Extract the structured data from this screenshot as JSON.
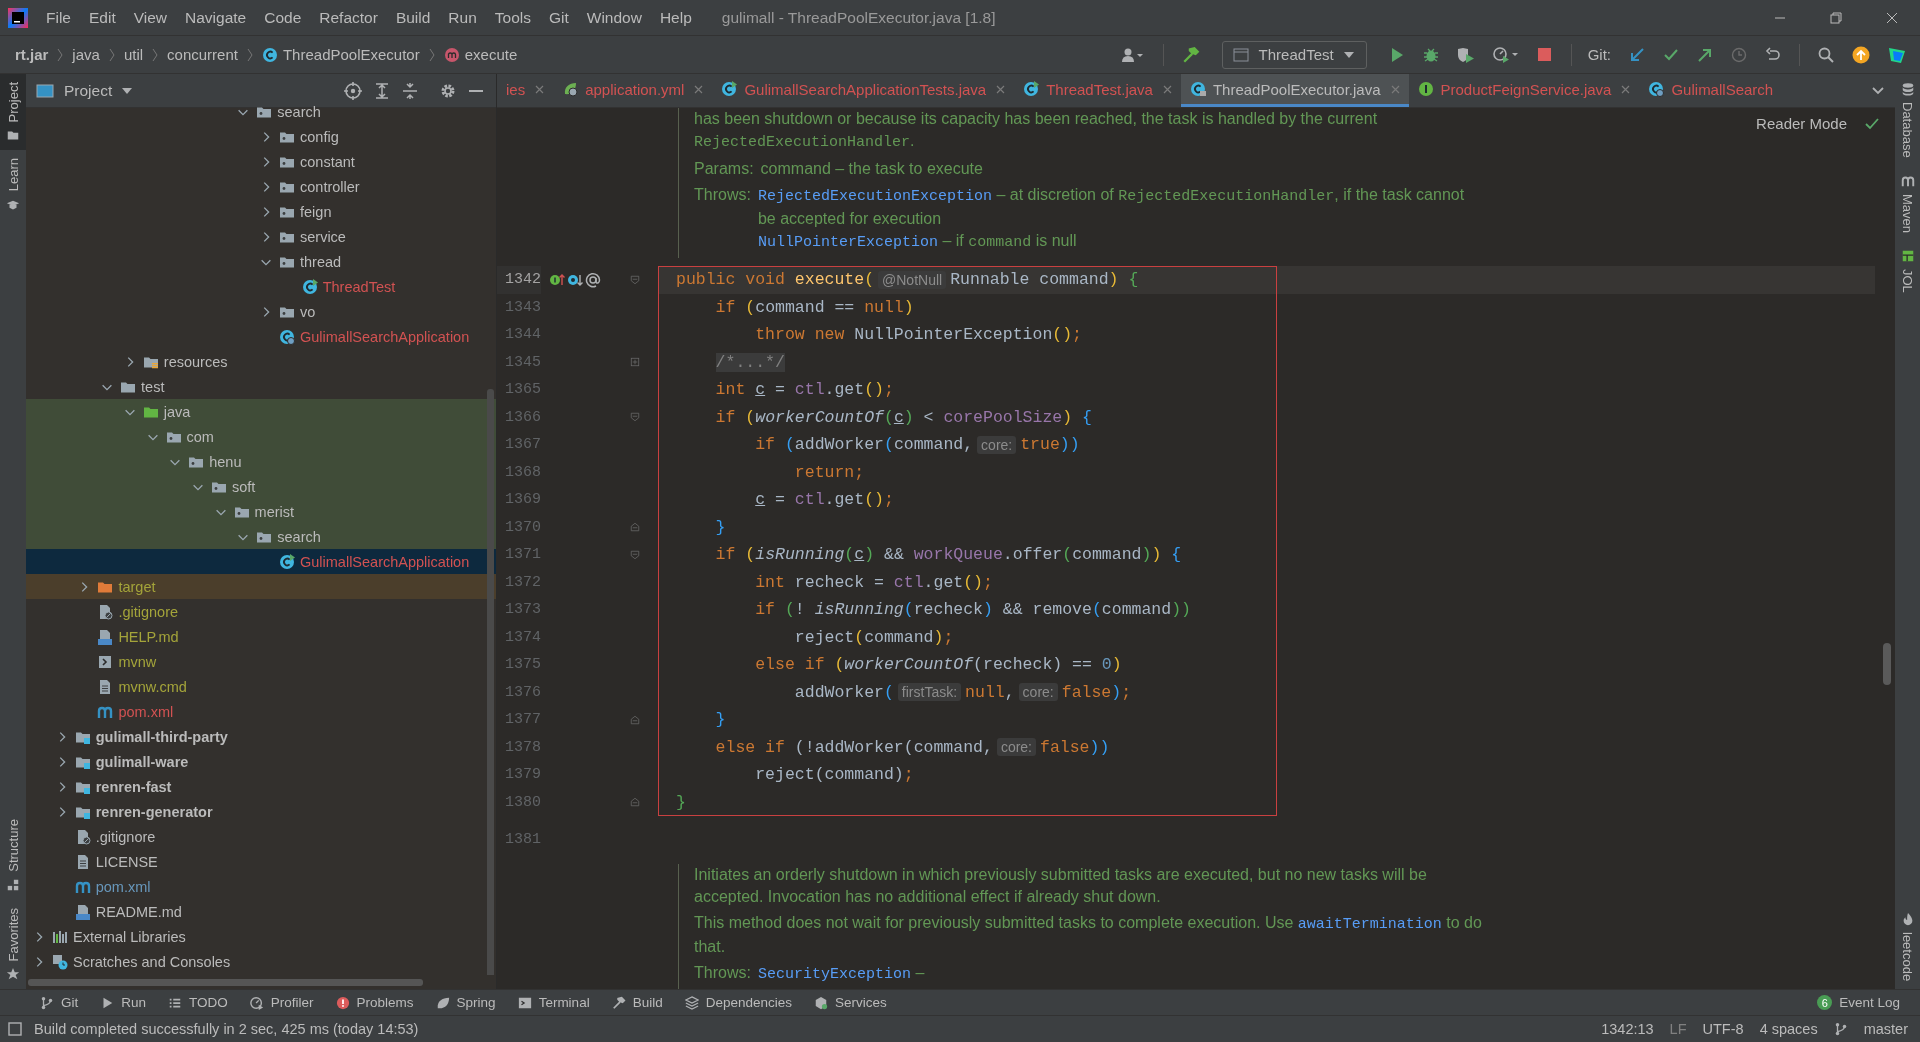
{
  "window": {
    "title": "gulimall - ThreadPoolExecutor.java [1.8]"
  },
  "menu": [
    "File",
    "Edit",
    "View",
    "Navigate",
    "Code",
    "Refactor",
    "Build",
    "Run",
    "Tools",
    "Git",
    "Window",
    "Help"
  ],
  "breadcrumbs": [
    {
      "label": "rt.jar",
      "kind": "root"
    },
    {
      "label": "java",
      "kind": "plain"
    },
    {
      "label": "util",
      "kind": "plain"
    },
    {
      "label": "concurrent",
      "kind": "plain"
    },
    {
      "label": "ThreadPoolExecutor",
      "kind": "class"
    },
    {
      "label": "execute",
      "kind": "method"
    }
  ],
  "run_config": {
    "label": "ThreadTest"
  },
  "git_label": "Git:",
  "left_strip": {
    "top": [
      {
        "label": "Project",
        "kind": "folder",
        "selected": true
      },
      {
        "label": "Learn",
        "kind": "cap",
        "selected": false
      }
    ],
    "bottom": [
      {
        "label": "Structure",
        "kind": "blocks",
        "selected": false
      },
      {
        "label": "Favorites",
        "kind": "star",
        "selected": false
      }
    ]
  },
  "right_strip": {
    "top": [
      {
        "label": "Database",
        "kind": "db"
      },
      {
        "label": "Maven",
        "kind": "maven"
      },
      {
        "label": "JOL",
        "kind": "jol"
      }
    ],
    "bottom": [
      {
        "label": "leetcode",
        "kind": "leet"
      }
    ]
  },
  "project_panel": {
    "title": "Project"
  },
  "tree": [
    {
      "children": [
        {
          "children": [
            {
              "children": [
                {
                  "children": [
                    {
                      "children": [
                        {
                          "children": [
                            {
                              "children": [
                                {
                                  "children": [
                                    {
                                      "children": [
                                        {
                                          "label": "search",
                                          "kind": "package",
                                          "expanded": true,
                                          "selected": false,
                                          "children": [
                                            {
                                              "label": "config",
                                              "kind": "package",
                                              "expanded": false,
                                              "selected": false
                                            },
                                            {
                                              "label": "constant",
                                              "kind": "package",
                                              "expanded": false,
                                              "selected": false
                                            },
                                            {
                                              "label": "controller",
                                              "kind": "package",
                                              "expanded": false,
                                              "selected": false
                                            },
                                            {
                                              "label": "feign",
                                              "kind": "package",
                                              "expanded": false,
                                              "selected": false
                                            },
                                            {
                                              "label": "service",
                                              "kind": "package",
                                              "expanded": false,
                                              "selected": false
                                            },
                                            {
                                              "label": "thread",
                                              "kind": "package",
                                              "expanded": true,
                                              "selected": false,
                                              "children": [
                                                {
                                                  "label": "ThreadTest",
                                                  "kind": "class-run",
                                                  "selected": false,
                                                  "color": "#d25252"
                                                }
                                              ]
                                            },
                                            {
                                              "label": "vo",
                                              "kind": "package",
                                              "expanded": false,
                                              "selected": false
                                            },
                                            {
                                              "label": "GulimallSearchApplication",
                                              "kind": "spring-app",
                                              "selected": false,
                                              "color": "#d25252"
                                            }
                                          ]
                                        }
                                      ]
                                    }
                                  ]
                                }
                              ]
                            }
                          ]
                        }
                      ]
                    },
                    {
                      "label": "resources",
                      "kind": "resources",
                      "expanded": false,
                      "selected": false
                    }
                  ]
                },
                {
                  "label": "test",
                  "kind": "folder",
                  "expanded": true,
                  "selected": false,
                  "children": [
                    {
                      "label": "java",
                      "kind": "test-root",
                      "expanded": true,
                      "selected": false,
                      "children": [
                        {
                          "label": "com",
                          "kind": "package",
                          "expanded": true,
                          "selected": false,
                          "children": [
                            {
                              "label": "henu",
                              "kind": "package",
                              "expanded": true,
                              "selected": false,
                              "children": [
                                {
                                  "label": "soft",
                                  "kind": "package",
                                  "expanded": true,
                                  "selected": false,
                                  "children": [
                                    {
                                      "label": "merist",
                                      "kind": "package",
                                      "expanded": true,
                                      "selected": false,
                                      "children": [
                                        {
                                          "label": "search",
                                          "kind": "package",
                                          "expanded": true,
                                          "selected": false,
                                          "children": [
                                            {
                                              "label": "GulimallSearchApplication",
                                              "kind": "class-run",
                                              "selected": true,
                                              "color": "#d25252"
                                            }
                                          ]
                                        }
                                      ]
                                    }
                                  ]
                                }
                              ]
                            }
                          ]
                        }
                      ]
                    }
                  ]
                }
              ]
            },
            {
              "label": "target",
              "kind": "excluded",
              "expanded": false,
              "selected": false,
              "color": "#a4a43a"
            },
            {
              "label": ".gitignore",
              "kind": "ignore",
              "selected": false,
              "color": "#a4a43a"
            },
            {
              "label": "HELP.md",
              "kind": "md",
              "selected": false,
              "color": "#a4a43a"
            },
            {
              "label": "mvnw",
              "kind": "script",
              "selected": false,
              "color": "#a4a43a"
            },
            {
              "label": "mvnw.cmd",
              "kind": "file",
              "selected": false,
              "color": "#a4a43a"
            },
            {
              "label": "pom.xml",
              "kind": "maven",
              "selected": false,
              "color": "#d25252"
            }
          ]
        },
        {
          "label": "gulimall-third-party",
          "kind": "module",
          "expanded": false,
          "selected": false
        },
        {
          "label": "gulimall-ware",
          "kind": "module",
          "expanded": false,
          "selected": false
        },
        {
          "label": "renren-fast",
          "kind": "module",
          "expanded": false,
          "selected": false
        },
        {
          "label": "renren-generator",
          "kind": "module",
          "expanded": false,
          "selected": false
        },
        {
          "label": ".gitignore",
          "kind": "ignore",
          "selected": false
        },
        {
          "label": "LICENSE",
          "kind": "file",
          "selected": false
        },
        {
          "label": "pom.xml",
          "kind": "maven",
          "selected": false,
          "color": "#6897bb"
        },
        {
          "label": "README.md",
          "kind": "md",
          "selected": false
        }
      ]
    },
    {
      "label": "External Libraries",
      "kind": "libraries",
      "expanded": false,
      "selected": false
    },
    {
      "label": "Scratches and Consoles",
      "kind": "scratches",
      "expanded": false,
      "selected": false
    }
  ],
  "tabs": [
    {
      "label": "ies",
      "kind": "none",
      "color": "#d25252",
      "selected": false
    },
    {
      "label": "application.yml",
      "kind": "yml",
      "color": "#d25252",
      "selected": false
    },
    {
      "label": "GulimallSearchApplicationTests.java",
      "kind": "class-run",
      "color": "#d25252",
      "selected": false
    },
    {
      "label": "ThreadTest.java",
      "kind": "class-run",
      "color": "#d25252",
      "selected": false
    },
    {
      "label": "ThreadPoolExecutor.java",
      "kind": "class-locked",
      "color": "#bbbbbb",
      "selected": true
    },
    {
      "label": "ProductFeignService.java",
      "kind": "interface",
      "color": "#d25252",
      "selected": false
    },
    {
      "label": "GulimallSearch",
      "kind": "spring-app",
      "color": "#d25252",
      "selected": false
    }
  ],
  "editor": {
    "reader_mode": "Reader Mode",
    "items": [
      {
        "kind": "doc",
        "paragraphs": [
          {
            "lines": [
              [
                {
                  "text": "has been shutdown or because its capacity has been reached, the task is handled by the current ",
                  "kind": "text"
                },
                {
                  "text": "RejectedExecutionHandler",
                  "kind": "code"
                },
                {
                  "text": ".",
                  "kind": "text"
                }
              ]
            ]
          },
          {
            "label": "Params:",
            "lines": [
              [
                {
                  "text": "command – the task to execute",
                  "kind": "text"
                }
              ]
            ]
          },
          {
            "label": "Throws:",
            "lines": [
              [
                {
                  "text": "RejectedExecutionException",
                  "kind": "link"
                },
                {
                  "text": " – at discretion of ",
                  "kind": "text"
                },
                {
                  "text": "RejectedExecutionHandler",
                  "kind": "code"
                },
                {
                  "text": ", if the task cannot be accepted for execution",
                  "kind": "text"
                }
              ],
              [
                {
                  "text": "NullPointerException",
                  "kind": "link"
                },
                {
                  "text": " – if ",
                  "kind": "text"
                },
                {
                  "text": "command",
                  "kind": "code"
                },
                {
                  "text": " is null",
                  "kind": "text"
                }
              ]
            ]
          }
        ]
      },
      {
        "kind": "code",
        "framed": true,
        "lines": [
          {
            "number": "1342",
            "current": true,
            "gutter": [
              {
                "kind": "implementing"
              },
              {
                "kind": "overridden"
              },
              {
                "kind": "annotation"
              }
            ],
            "fold": {
              "kind": "open"
            },
            "tokens": [
              {
                "text": "public void ",
                "kind": "k"
              },
              {
                "text": "execute",
                "kind": "f"
              },
              {
                "text": "(",
                "kind": "y"
              },
              {
                "text": "@NotNull",
                "kind": "h"
              },
              {
                "text": "Runnable command",
                "kind": "p"
              },
              {
                "text": ")",
                "kind": "y"
              },
              {
                "text": " {",
                "kind": "g"
              }
            ]
          },
          {
            "number": "1343",
            "current": false,
            "tokens": [
              {
                "text": "    if ",
                "kind": "k"
              },
              {
                "text": "(",
                "kind": "y"
              },
              {
                "text": "command == ",
                "kind": "p"
              },
              {
                "text": "null",
                "kind": "k"
              },
              {
                "text": ")",
                "kind": "y"
              }
            ]
          },
          {
            "number": "1344",
            "current": false,
            "tokens": [
              {
                "text": "        throw new ",
                "kind": "k"
              },
              {
                "text": "NullPointerException",
                "kind": "p"
              },
              {
                "text": "()",
                "kind": "y"
              },
              {
                "text": ";",
                "kind": "k"
              }
            ]
          },
          {
            "number": "1345",
            "current": false,
            "fold": {
              "kind": "collapsed"
            },
            "tokens": [
              {
                "text": "    /*...*/",
                "kind": "c"
              }
            ]
          },
          {
            "number": "1365",
            "current": false,
            "tokens": [
              {
                "text": "    int ",
                "kind": "k"
              },
              {
                "text": "c",
                "kind": "u"
              },
              {
                "text": " = ",
                "kind": "p"
              },
              {
                "text": "ctl",
                "kind": "v"
              },
              {
                "text": ".get",
                "kind": "p"
              },
              {
                "text": "()",
                "kind": "y"
              },
              {
                "text": ";",
                "kind": "k"
              }
            ]
          },
          {
            "number": "1366",
            "current": false,
            "fold": {
              "kind": "open"
            },
            "tokens": [
              {
                "text": "    if ",
                "kind": "k"
              },
              {
                "text": "(",
                "kind": "y"
              },
              {
                "text": "workerCountOf",
                "kind": "i"
              },
              {
                "text": "(",
                "kind": "g"
              },
              {
                "text": "c",
                "kind": "u"
              },
              {
                "text": ")",
                "kind": "g"
              },
              {
                "text": " < ",
                "kind": "p"
              },
              {
                "text": "corePoolSize",
                "kind": "v"
              },
              {
                "text": ")",
                "kind": "y"
              },
              {
                "text": " {",
                "kind": "b"
              }
            ]
          },
          {
            "number": "1367",
            "current": false,
            "tokens": [
              {
                "text": "        if ",
                "kind": "k"
              },
              {
                "text": "(",
                "kind": "b"
              },
              {
                "text": "addWorker",
                "kind": "p"
              },
              {
                "text": "(",
                "kind": "b"
              },
              {
                "text": "command,",
                "kind": "p"
              },
              {
                "text": "core:",
                "kind": "h"
              },
              {
                "text": "true",
                "kind": "k"
              },
              {
                "text": "))",
                "kind": "b"
              }
            ]
          },
          {
            "number": "1368",
            "current": false,
            "tokens": [
              {
                "text": "            return",
                "kind": "k"
              },
              {
                "text": ";",
                "kind": "k"
              }
            ]
          },
          {
            "number": "1369",
            "current": false,
            "tokens": [
              {
                "text": "        c",
                "kind": "u"
              },
              {
                "text": " = ",
                "kind": "p"
              },
              {
                "text": "ctl",
                "kind": "v"
              },
              {
                "text": ".get",
                "kind": "p"
              },
              {
                "text": "()",
                "kind": "y"
              },
              {
                "text": ";",
                "kind": "k"
              }
            ]
          },
          {
            "number": "1370",
            "current": false,
            "fold": {
              "kind": "close"
            },
            "tokens": [
              {
                "text": "    }",
                "kind": "b"
              }
            ]
          },
          {
            "number": "1371",
            "current": false,
            "fold": {
              "kind": "open"
            },
            "tokens": [
              {
                "text": "    if ",
                "kind": "k"
              },
              {
                "text": "(",
                "kind": "y"
              },
              {
                "text": "isRunning",
                "kind": "i"
              },
              {
                "text": "(",
                "kind": "g"
              },
              {
                "text": "c",
                "kind": "u"
              },
              {
                "text": ")",
                "kind": "g"
              },
              {
                "text": " && ",
                "kind": "p"
              },
              {
                "text": "workQueue",
                "kind": "v"
              },
              {
                "text": ".offer",
                "kind": "p"
              },
              {
                "text": "(",
                "kind": "g"
              },
              {
                "text": "command",
                "kind": "p"
              },
              {
                "text": ")",
                "kind": "g"
              },
              {
                "text": ")",
                "kind": "y"
              },
              {
                "text": " {",
                "kind": "b"
              }
            ]
          },
          {
            "number": "1372",
            "current": false,
            "tokens": [
              {
                "text": "        int ",
                "kind": "k"
              },
              {
                "text": "recheck = ",
                "kind": "p"
              },
              {
                "text": "ctl",
                "kind": "v"
              },
              {
                "text": ".get",
                "kind": "p"
              },
              {
                "text": "()",
                "kind": "y"
              },
              {
                "text": ";",
                "kind": "k"
              }
            ]
          },
          {
            "number": "1373",
            "current": false,
            "tokens": [
              {
                "text": "        if ",
                "kind": "k"
              },
              {
                "text": "(",
                "kind": "g"
              },
              {
                "text": "! ",
                "kind": "p"
              },
              {
                "text": "isRunning",
                "kind": "i"
              },
              {
                "text": "(",
                "kind": "b"
              },
              {
                "text": "recheck",
                "kind": "p"
              },
              {
                "text": ")",
                "kind": "b"
              },
              {
                "text": " && remove",
                "kind": "p"
              },
              {
                "text": "(",
                "kind": "b"
              },
              {
                "text": "command",
                "kind": "p"
              },
              {
                "text": "))",
                "kind": "g"
              }
            ]
          },
          {
            "number": "1374",
            "current": false,
            "tokens": [
              {
                "text": "            reject",
                "kind": "p"
              },
              {
                "text": "(",
                "kind": "y"
              },
              {
                "text": "command",
                "kind": "p"
              },
              {
                "text": ")",
                "kind": "y"
              },
              {
                "text": ";",
                "kind": "k"
              }
            ]
          },
          {
            "number": "1375",
            "current": false,
            "tokens": [
              {
                "text": "        else if ",
                "kind": "k"
              },
              {
                "text": "(",
                "kind": "y"
              },
              {
                "text": "workerCountOf",
                "kind": "i"
              },
              {
                "text": "(recheck) == ",
                "kind": "p"
              },
              {
                "text": "0",
                "kind": "n"
              },
              {
                "text": ")",
                "kind": "y"
              }
            ]
          },
          {
            "number": "1376",
            "current": false,
            "tokens": [
              {
                "text": "            addWorker",
                "kind": "p"
              },
              {
                "text": "(",
                "kind": "b"
              },
              {
                "text": "firstTask:",
                "kind": "h"
              },
              {
                "text": "null",
                "kind": "k"
              },
              {
                "text": ",",
                "kind": "p"
              },
              {
                "text": "core:",
                "kind": "h"
              },
              {
                "text": "false",
                "kind": "k"
              },
              {
                "text": ")",
                "kind": "b"
              },
              {
                "text": ";",
                "kind": "k"
              }
            ]
          },
          {
            "number": "1377",
            "current": false,
            "fold": {
              "kind": "close"
            },
            "tokens": [
              {
                "text": "    }",
                "kind": "b"
              }
            ]
          },
          {
            "number": "1378",
            "current": false,
            "tokens": [
              {
                "text": "    else if ",
                "kind": "k"
              },
              {
                "text": "(!addWorker(command,",
                "kind": "p"
              },
              {
                "text": "core:",
                "kind": "h"
              },
              {
                "text": "false",
                "kind": "k"
              },
              {
                "text": "))",
                "kind": "b"
              }
            ]
          },
          {
            "number": "1379",
            "current": false,
            "tokens": [
              {
                "text": "        reject",
                "kind": "p"
              },
              {
                "text": "(command)",
                "kind": "p"
              },
              {
                "text": ";",
                "kind": "k"
              }
            ]
          },
          {
            "number": "1380",
            "current": false,
            "fold": {
              "kind": "close"
            },
            "tokens": [
              {
                "text": "}",
                "kind": "g"
              }
            ]
          }
        ]
      },
      {
        "kind": "code",
        "framed": false,
        "lines": [
          {
            "number": "1381",
            "current": false
          }
        ]
      },
      {
        "kind": "doc",
        "paragraphs": [
          {
            "lines": [
              [
                {
                  "text": "Initiates an orderly shutdown in which previously submitted tasks are executed, but no new tasks will be accepted. Invocation has no additional effect if already shut down.",
                  "kind": "text"
                }
              ]
            ]
          },
          {
            "lines": [
              [
                {
                  "text": "This method does not wait for previously submitted tasks to complete execution. Use ",
                  "kind": "text"
                },
                {
                  "text": "awaitTermination",
                  "kind": "link"
                },
                {
                  "text": " to do that.",
                  "kind": "text"
                }
              ]
            ]
          },
          {
            "label": "Throws:",
            "lines": [
              [
                {
                  "text": "SecurityException",
                  "kind": "link"
                },
                {
                  "text": " –",
                  "kind": "text"
                }
              ]
            ]
          }
        ]
      }
    ]
  },
  "bottom_tools": [
    {
      "label": "Git",
      "kind": "git"
    },
    {
      "label": "Run",
      "kind": "run"
    },
    {
      "label": "TODO",
      "kind": "todo"
    },
    {
      "label": "Profiler",
      "kind": "profiler"
    },
    {
      "label": "Problems",
      "kind": "problems"
    },
    {
      "label": "Spring",
      "kind": "spring"
    },
    {
      "label": "Terminal",
      "kind": "terminal"
    },
    {
      "label": "Build",
      "kind": "build"
    },
    {
      "label": "Dependencies",
      "kind": "deps"
    },
    {
      "label": "Services",
      "kind": "services"
    }
  ],
  "event_log": {
    "label": "Event Log",
    "count": "6"
  },
  "status": {
    "message": "Build completed successfully in 2 sec, 425 ms (today 14:53)",
    "position": "1342:13",
    "line_separator": "LF",
    "encoding": "UTF-8",
    "indent": "4 spaces",
    "branch": "master"
  }
}
